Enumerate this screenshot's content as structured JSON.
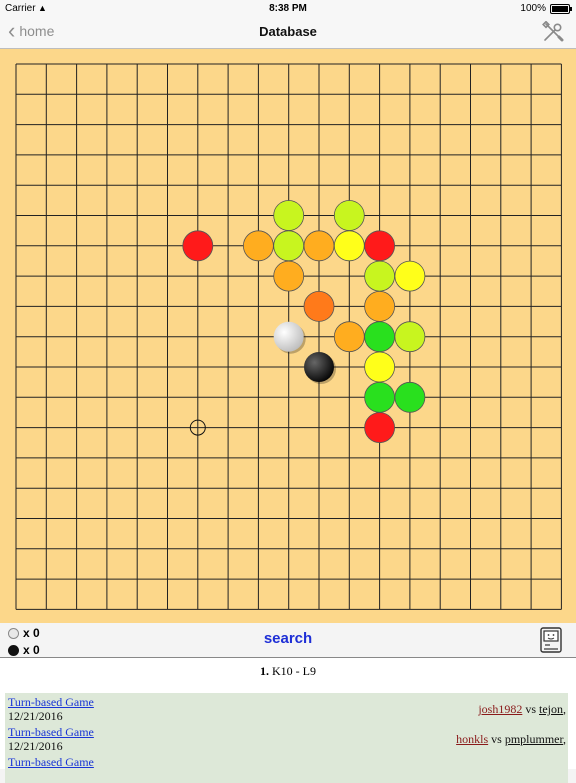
{
  "status": {
    "carrier": "Carrier",
    "time": "8:38 PM",
    "battery": "100%"
  },
  "nav": {
    "back_label": "home",
    "title": "Database",
    "tools_icon": "tools-icon"
  },
  "board": {
    "size": 18,
    "marker": [
      6,
      12
    ],
    "colors": {
      "red": "#ff1a1a",
      "orange": "#ff7a1a",
      "lightorange": "#ffad1f",
      "yellow": "#ffff1a",
      "yellowgreen": "#c8f51f",
      "green": "#29e01e",
      "white": "#ffffff",
      "black": "#111111"
    },
    "stones": [
      {
        "col": 9,
        "row": 5,
        "color": "yellowgreen"
      },
      {
        "col": 11,
        "row": 5,
        "color": "yellowgreen"
      },
      {
        "col": 6,
        "row": 6,
        "color": "red"
      },
      {
        "col": 8,
        "row": 6,
        "color": "lightorange"
      },
      {
        "col": 9,
        "row": 6,
        "color": "yellowgreen"
      },
      {
        "col": 10,
        "row": 6,
        "color": "lightorange"
      },
      {
        "col": 11,
        "row": 6,
        "color": "yellow"
      },
      {
        "col": 12,
        "row": 6,
        "color": "red"
      },
      {
        "col": 9,
        "row": 7,
        "color": "lightorange"
      },
      {
        "col": 12,
        "row": 7,
        "color": "yellowgreen"
      },
      {
        "col": 13,
        "row": 7,
        "color": "yellow"
      },
      {
        "col": 10,
        "row": 8,
        "color": "orange"
      },
      {
        "col": 12,
        "row": 8,
        "color": "lightorange"
      },
      {
        "col": 9,
        "row": 9,
        "color": "white"
      },
      {
        "col": 11,
        "row": 9,
        "color": "lightorange"
      },
      {
        "col": 12,
        "row": 9,
        "color": "green"
      },
      {
        "col": 13,
        "row": 9,
        "color": "yellowgreen"
      },
      {
        "col": 10,
        "row": 10,
        "color": "black"
      },
      {
        "col": 12,
        "row": 10,
        "color": "yellow"
      },
      {
        "col": 12,
        "row": 11,
        "color": "green"
      },
      {
        "col": 13,
        "row": 11,
        "color": "green"
      },
      {
        "col": 12,
        "row": 12,
        "color": "red"
      }
    ]
  },
  "controls": {
    "white_captures": "x 0",
    "black_captures": "x 0",
    "search_label": "search",
    "mac_icon": "computer-icon"
  },
  "database": {
    "move_number": "1.",
    "move_text": "K10 - L9",
    "games": [
      {
        "title": "Turn-based Game",
        "date": "12/21/2016",
        "player1": "josh1982",
        "vs": "vs",
        "player2": "tejon",
        "trail": ","
      },
      {
        "title": "Turn-based Game",
        "date": "12/21/2016",
        "player1": "honkls",
        "vs": "vs",
        "player2": "pmplummer",
        "trail": ","
      },
      {
        "title": "Turn-based Game",
        "date": "",
        "player1": "",
        "vs": "",
        "player2": "",
        "trail": ""
      }
    ]
  }
}
